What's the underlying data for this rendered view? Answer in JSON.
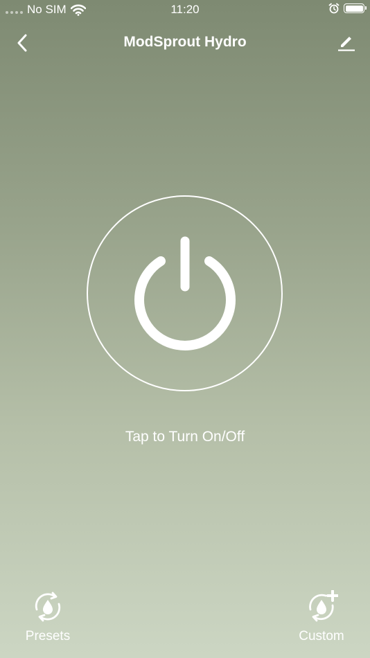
{
  "status_bar": {
    "carrier": "No SIM",
    "time": "11:20",
    "icons": [
      "signal-dots-icon",
      "wifi-icon",
      "alarm-icon",
      "battery-icon"
    ]
  },
  "nav": {
    "title": "ModSprout Hydro",
    "back_icon": "chevron-left-icon",
    "edit_icon": "pencil-icon"
  },
  "power": {
    "icon": "power-icon",
    "hint": "Tap to Turn On/Off"
  },
  "bottom": {
    "presets_label": "Presets",
    "custom_label": "Custom"
  },
  "colors": {
    "gradient_top": "#7e8a72",
    "gradient_bottom": "#ccd6c3",
    "foreground": "#ffffff"
  }
}
